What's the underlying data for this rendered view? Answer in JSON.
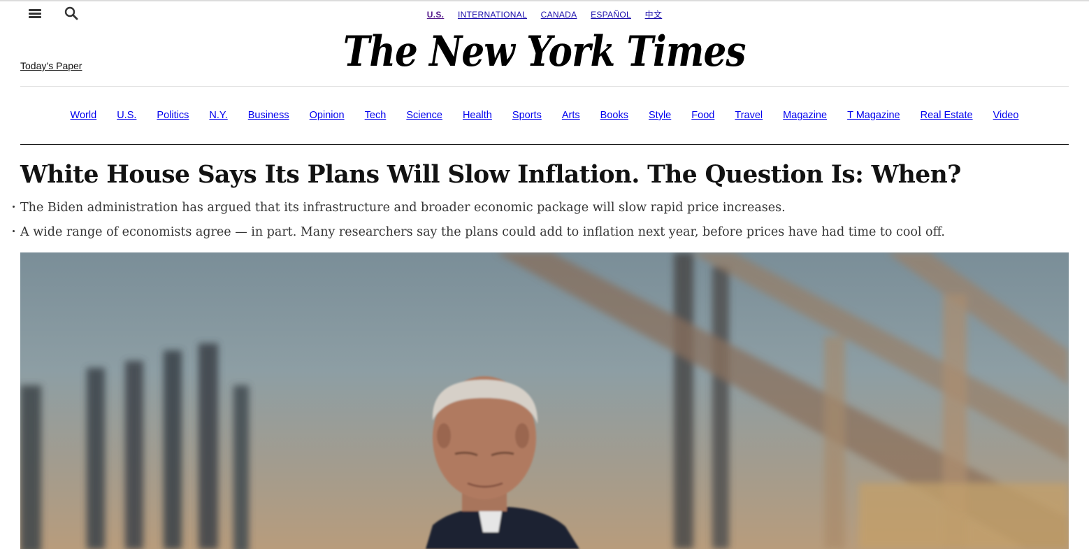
{
  "editions": [
    "U.S.",
    "INTERNATIONAL",
    "CANADA",
    "ESPAÑOL",
    "中文"
  ],
  "masthead": "The New York Times",
  "todays_paper": "Today’s Paper",
  "sections": [
    "World",
    "U.S.",
    "Politics",
    "N.Y.",
    "Business",
    "Opinion",
    "Tech",
    "Science",
    "Health",
    "Sports",
    "Arts",
    "Books",
    "Style",
    "Food",
    "Travel",
    "Magazine",
    "T Magazine",
    "Real Estate",
    "Video"
  ],
  "article": {
    "headline": "White House Says Its Plans Will Slow Inflation. The Question Is: When?",
    "summary": [
      "The Biden administration has argued that its infrastructure and broader economic package will slow rapid price increases.",
      "A wide range of economists agree — in part. Many researchers say the plans could add to inflation next year, before prices have had time to cool off."
    ]
  }
}
